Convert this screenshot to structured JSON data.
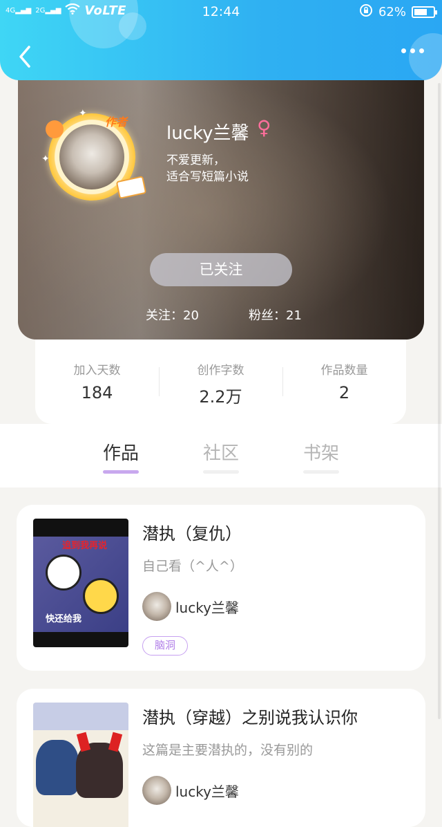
{
  "status_bar": {
    "network_labels": [
      "4G",
      "2G"
    ],
    "volte": "VoLTE",
    "time": "12:44",
    "battery": "62%"
  },
  "header": {
    "back_icon": "chevron-left-icon",
    "more_icon": "more-dots-icon",
    "color": "#2fb0f2"
  },
  "profile": {
    "badge": "作者",
    "username": "lucky兰馨",
    "gender_symbol": "♀",
    "bio_line1": "不爱更新，",
    "bio_line2": "适合写短篇小说",
    "follow_button": "已关注",
    "following_label": "关注：20",
    "followers_label": "粉丝：21"
  },
  "stats": [
    {
      "label": "加入天数",
      "value": "184"
    },
    {
      "label": "创作字数",
      "value": "2.2万"
    },
    {
      "label": "作品数量",
      "value": "2"
    }
  ],
  "tabs": [
    {
      "label": "作品",
      "active": true
    },
    {
      "label": "社区",
      "active": false
    },
    {
      "label": "书架",
      "active": false
    }
  ],
  "works": [
    {
      "title": "潜执（复仇）",
      "desc": "自己看（^人^）",
      "author": "lucky兰馨",
      "tag": "脑洞",
      "cover_text_top": "追到我再说",
      "cover_text_bottom": "快还给我"
    },
    {
      "title": "潜执（穿越）之别说我认识你",
      "desc": "这篇是主要潜执的，没有别的",
      "author": "lucky兰馨"
    }
  ]
}
